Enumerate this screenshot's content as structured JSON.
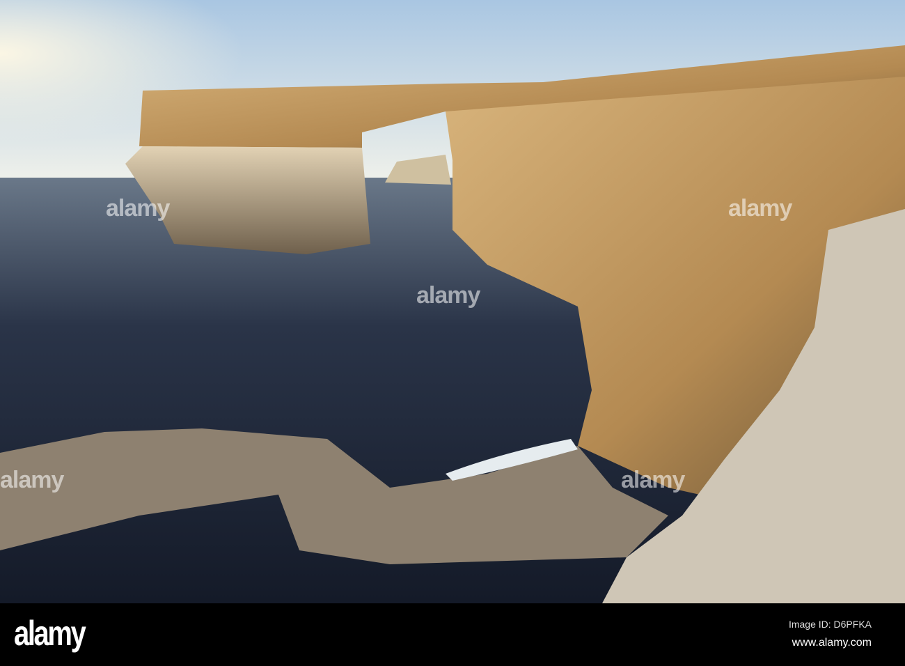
{
  "watermark": {
    "brand": "alamy",
    "image_id": "Image ID: D6PFKA",
    "url": "www.alamy.com"
  },
  "colors": {
    "sky_top": "#a9c6e2",
    "sky_horizon": "#f3efe0",
    "sea": "#1c2538",
    "rock_light": "#d9b27a",
    "rock_shadow": "#6b5536"
  }
}
